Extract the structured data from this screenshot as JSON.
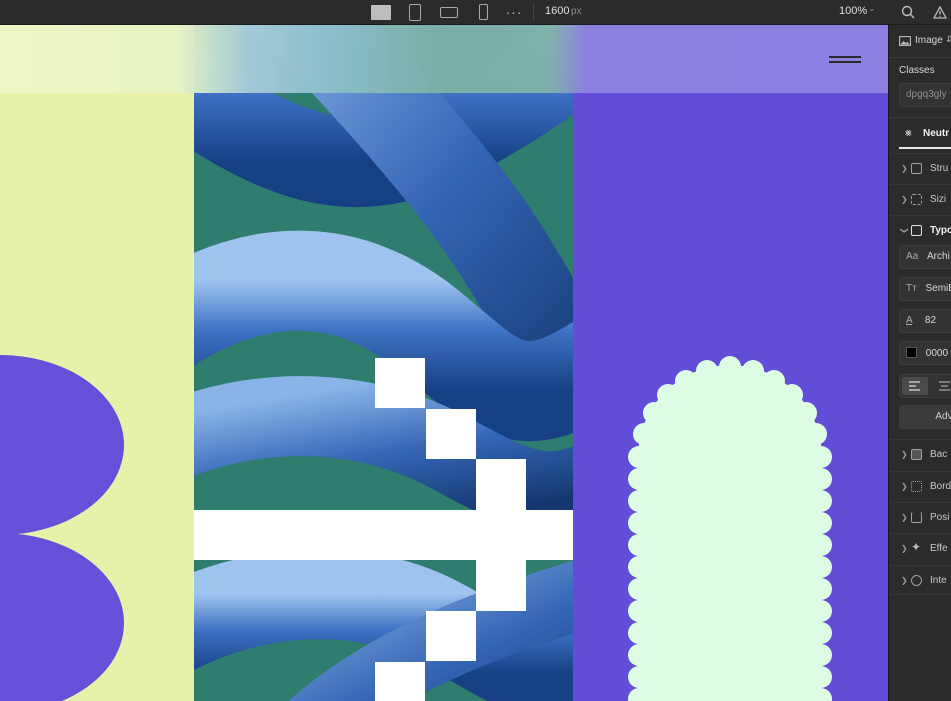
{
  "toolbar": {
    "width_value": "1600",
    "width_unit": "px",
    "zoom": "100%",
    "more": "···"
  },
  "panel": {
    "element_type": "Image",
    "classes_label": "Classes",
    "class_name": "dpgq3gly",
    "tab_label": "Neutr",
    "sections": {
      "structure": "Stru",
      "sizing": "Sizi",
      "typography": "Typo",
      "background": "Bac",
      "border": "Bord",
      "position": "Posi",
      "effects": "Effe",
      "interactions": "Inte"
    },
    "typography": {
      "font_family_icon": "Aa",
      "font_family": "Archi",
      "weight_icon": "Tт",
      "font_weight": "SemiB",
      "font_size": "82",
      "color": "0000",
      "advanced": "Adv"
    }
  },
  "colors": {
    "lime": "#e8f1aa",
    "purple": "#624dd9",
    "mint": "#dcfce3",
    "teal": "#2f7d6e"
  }
}
